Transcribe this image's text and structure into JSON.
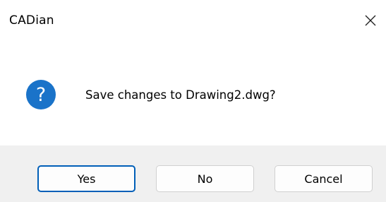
{
  "window": {
    "title": "CADian",
    "close_icon": "close-icon"
  },
  "dialog": {
    "icon": "question-icon",
    "icon_color": "#1a73c9",
    "message": "Save changes to Drawing2.dwg?"
  },
  "buttons": {
    "yes_label": "Yes",
    "no_label": "No",
    "cancel_label": "Cancel",
    "default": "Yes"
  },
  "colors": {
    "footer_bg": "#f0f0f0",
    "default_button_border": "#005fb8"
  }
}
